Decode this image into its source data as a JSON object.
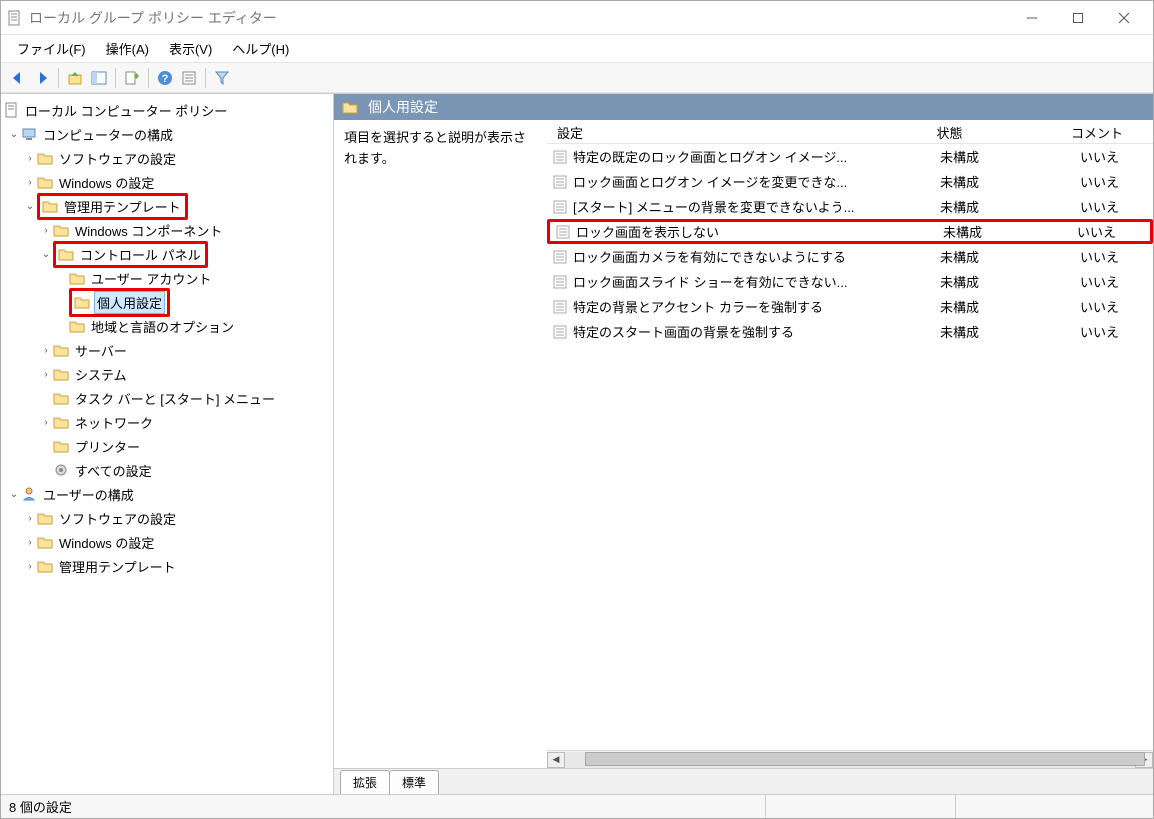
{
  "window": {
    "title": "ローカル グループ ポリシー エディター"
  },
  "menu": {
    "file": "ファイル(F)",
    "action": "操作(A)",
    "view": "表示(V)",
    "help": "ヘルプ(H)"
  },
  "tree": {
    "root": "ローカル コンピューター ポリシー",
    "computer_config": "コンピューターの構成",
    "software_settings": "ソフトウェアの設定",
    "windows_settings": "Windows の設定",
    "admin_templates": "管理用テンプレート",
    "windows_components": "Windows コンポーネント",
    "control_panel": "コントロール パネル",
    "user_accounts": "ユーザー アカウント",
    "personalization": "個人用設定",
    "region_language": "地域と言語のオプション",
    "server": "サーバー",
    "system": "システム",
    "taskbar_start": "タスク バーと [スタート] メニュー",
    "network": "ネットワーク",
    "printers": "プリンター",
    "all_settings": "すべての設定",
    "user_config": "ユーザーの構成",
    "u_software": "ソフトウェアの設定",
    "u_windows": "Windows の設定",
    "u_admin": "管理用テンプレート"
  },
  "detail": {
    "header": "個人用設定",
    "desc": "項目を選択すると説明が表示されます。",
    "cols": {
      "setting": "設定",
      "state": "状態",
      "comment": "コメント"
    },
    "tabs": {
      "extended": "拡張",
      "standard": "標準"
    },
    "rows": [
      {
        "setting": "特定の既定のロック画面とログオン イメージ...",
        "state": "未構成",
        "comment": "いいえ",
        "hl": false
      },
      {
        "setting": "ロック画面とログオン イメージを変更できな...",
        "state": "未構成",
        "comment": "いいえ",
        "hl": false
      },
      {
        "setting": "[スタート] メニューの背景を変更できないよう...",
        "state": "未構成",
        "comment": "いいえ",
        "hl": false
      },
      {
        "setting": "ロック画面を表示しない",
        "state": "未構成",
        "comment": "いいえ",
        "hl": true
      },
      {
        "setting": "ロック画面カメラを有効にできないようにする",
        "state": "未構成",
        "comment": "いいえ",
        "hl": false
      },
      {
        "setting": "ロック画面スライド ショーを有効にできない...",
        "state": "未構成",
        "comment": "いいえ",
        "hl": false
      },
      {
        "setting": "特定の背景とアクセント カラーを強制する",
        "state": "未構成",
        "comment": "いいえ",
        "hl": false
      },
      {
        "setting": "特定のスタート画面の背景を強制する",
        "state": "未構成",
        "comment": "いいえ",
        "hl": false
      }
    ]
  },
  "status": {
    "text": "8 個の設定"
  }
}
